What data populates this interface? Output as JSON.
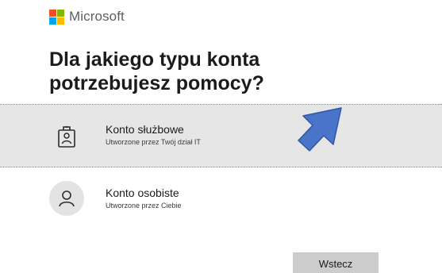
{
  "brand": {
    "name": "Microsoft",
    "logo_colors": [
      "#f25022",
      "#7fba00",
      "#00a4ef",
      "#ffb900"
    ]
  },
  "title": {
    "line1": "Dla jakiego typu konta",
    "line2": "potrzebujesz pomocy?"
  },
  "options": [
    {
      "label": "Konto służbowe",
      "subtitle": "Utworzone przez Twój dział IT",
      "icon": "work-badge-icon",
      "selected": true
    },
    {
      "label": "Konto osobiste",
      "subtitle": "Utworzone przez Ciebie",
      "icon": "person-icon",
      "selected": false
    }
  ],
  "back_button": {
    "label": "Wstecz"
  },
  "annotation": {
    "icon": "pointer-arrow-icon",
    "color": "#4a74c9"
  }
}
